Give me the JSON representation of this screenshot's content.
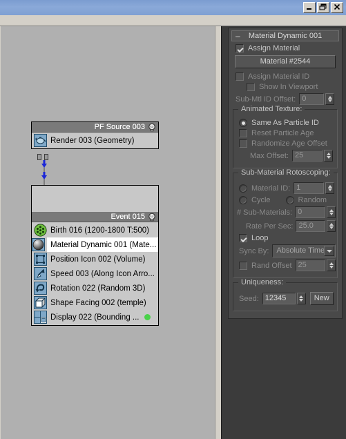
{
  "window": {
    "buttons": [
      {
        "name": "minimize",
        "glyph": "_"
      },
      {
        "name": "restore",
        "glyph": "❐"
      },
      {
        "name": "close",
        "glyph": "✕"
      }
    ]
  },
  "particle_view": {
    "source_node": {
      "title": "PF Source 003",
      "bulb_icon": "lightbulb-icon",
      "rows": [
        {
          "icon": "render-teapot-icon",
          "label": "Render 003 (Geometry)"
        }
      ]
    },
    "event_node": {
      "title": "Event 015",
      "bulb_icon": "lightbulb-icon",
      "rows": [
        {
          "icon": "birth-icon",
          "label": "Birth 016 (1200-1800 T:500)",
          "selected": false,
          "dot": false
        },
        {
          "icon": "material-dynamic-icon",
          "label": "Material Dynamic 001 (Mate...",
          "selected": true,
          "dot": false
        },
        {
          "icon": "position-icon",
          "label": "Position Icon 002 (Volume)",
          "selected": false,
          "dot": false
        },
        {
          "icon": "speed-icon",
          "label": "Speed 003 (Along Icon Arro...",
          "selected": false,
          "dot": false
        },
        {
          "icon": "rotation-icon",
          "label": "Rotation 022 (Random 3D)",
          "selected": false,
          "dot": false
        },
        {
          "icon": "shape-facing-icon",
          "label": "Shape Facing 002 (temple)",
          "selected": false,
          "dot": false
        },
        {
          "icon": "display-icon",
          "label": "Display 022 (Bounding ...",
          "selected": false,
          "dot": true
        }
      ]
    }
  },
  "command_panel": {
    "rollout": {
      "title": "Material Dynamic 001",
      "collapse_glyph": "–"
    },
    "assign_material": {
      "label": "Assign Material",
      "checked": true
    },
    "material_button": {
      "label": "Material #2544"
    },
    "assign_material_id": {
      "label": "Assign Material ID",
      "checked": false
    },
    "show_in_viewport": {
      "label": "Show In Viewport",
      "checked": false
    },
    "sub_mtl_id_offset": {
      "label": "Sub-Mtl ID Offset:",
      "value": "0"
    },
    "animated_texture": {
      "title": "Animated Texture:",
      "same_as_particle_id": {
        "label": "Same As Particle ID",
        "selected": true
      },
      "reset_particle_age": {
        "label": "Reset Particle Age",
        "checked": false
      },
      "randomize_age_offset": {
        "label": "Randomize Age Offset",
        "checked": false
      },
      "max_offset": {
        "label": "Max Offset:",
        "value": "25"
      }
    },
    "sub_material_rotoscoping": {
      "title": "Sub-Material Rotoscoping:",
      "material_id": {
        "label": "Material ID:",
        "selected": false,
        "value": "1"
      },
      "cycle": {
        "label": "Cycle",
        "selected": false
      },
      "random": {
        "label": "Random",
        "selected": false
      },
      "num_sub_materials": {
        "label": "# Sub-Materials:",
        "value": "0"
      },
      "rate_per_sec": {
        "label": "Rate Per Sec:",
        "value": "25.0"
      },
      "loop": {
        "label": "Loop",
        "checked": true
      },
      "sync_by": {
        "label": "Sync By:",
        "value": "Absolute Time"
      },
      "rand_offset": {
        "label": "Rand Offset",
        "checked": false,
        "value": "25"
      }
    },
    "uniqueness": {
      "title": "Uniqueness:",
      "seed_label": "Seed:",
      "seed_value": "12345",
      "new_button": "New"
    }
  },
  "colors": {
    "titlebar": "#7f9fd1",
    "chrome": "#d4d0c8",
    "canvas": "#b0b0b0",
    "panel_bg": "#3b3b3b",
    "panel_inner": "#494949",
    "node_body": "#c8c8c8",
    "node_title": "#7a7a7a",
    "selected_row": "#ffffff",
    "display_dot": "#4ad24a"
  }
}
